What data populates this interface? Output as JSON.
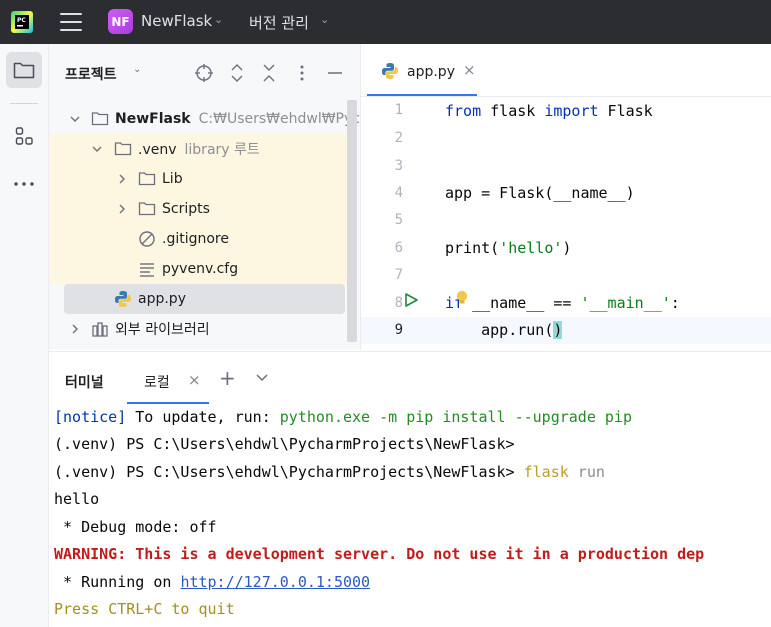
{
  "titlebar": {
    "project_badge": "NF",
    "project_name": "NewFlask",
    "vcs_label": "버전 관리"
  },
  "toolstrip": {
    "items": [
      "project-view",
      "structure",
      "more"
    ]
  },
  "project_panel": {
    "title": "프로젝트",
    "tree": [
      {
        "label": "NewFlask",
        "hint": "C:₩Users₩ehdwl₩Pycharm",
        "icon": "folder-icon",
        "expanded": true
      },
      {
        "label": ".venv",
        "hint": "library 루트",
        "icon": "folder-icon",
        "expanded": true
      },
      {
        "label": "Lib",
        "icon": "folder-icon",
        "expanded": false
      },
      {
        "label": "Scripts",
        "icon": "folder-icon",
        "expanded": false
      },
      {
        "label": ".gitignore",
        "icon": "ignore-file-icon"
      },
      {
        "label": "pyvenv.cfg",
        "icon": "text-file-icon"
      },
      {
        "label": "app.py",
        "icon": "python-file-icon",
        "selected": true
      },
      {
        "label": "외부 라이브러리",
        "icon": "library-icon",
        "expanded": false
      }
    ]
  },
  "editor": {
    "tab_label": "app.py",
    "lines": [
      {
        "n": "1"
      },
      {
        "n": "2"
      },
      {
        "n": "3"
      },
      {
        "n": "4"
      },
      {
        "n": "5"
      },
      {
        "n": "6"
      },
      {
        "n": "7"
      },
      {
        "n": "8"
      },
      {
        "n": "9"
      }
    ],
    "code": {
      "l1_kw1": "from",
      "l1_mid": " flask ",
      "l1_kw2": "import",
      "l1_end": " Flask",
      "l4": "app = Flask(__name__)",
      "l6_a": "print(",
      "l6_str": "'hello'",
      "l6_b": ")",
      "l8_kw": "if",
      "l8_mid": " __name__ == ",
      "l8_str": "'__main__'",
      "l8_end": ":",
      "l9_a": "    app.run(",
      "l9_b": ")"
    }
  },
  "terminal": {
    "title": "터미널",
    "tab_label": "로컬",
    "lines": {
      "l1_notice": "[notice]",
      "l1_mid": " To update, run: ",
      "l1_cmd": "python.exe -m pip install --upgrade pip",
      "l2": "(.venv) PS C:\\Users\\ehdwl\\PycharmProjects\\NewFlask>",
      "l3_prompt": "(.venv) PS C:\\Users\\ehdwl\\PycharmProjects\\NewFlask> ",
      "l3_cmd": "flask",
      "l3_arg": " run",
      "l4": "hello",
      "l5": " * Debug mode: off",
      "l6": "WARNING: This is a development server. Do not use it in a production dep",
      "l7_a": " * Running on ",
      "l7_link": "http://127.0.0.1:5000",
      "l8": "Press CTRL+C to quit"
    }
  }
}
